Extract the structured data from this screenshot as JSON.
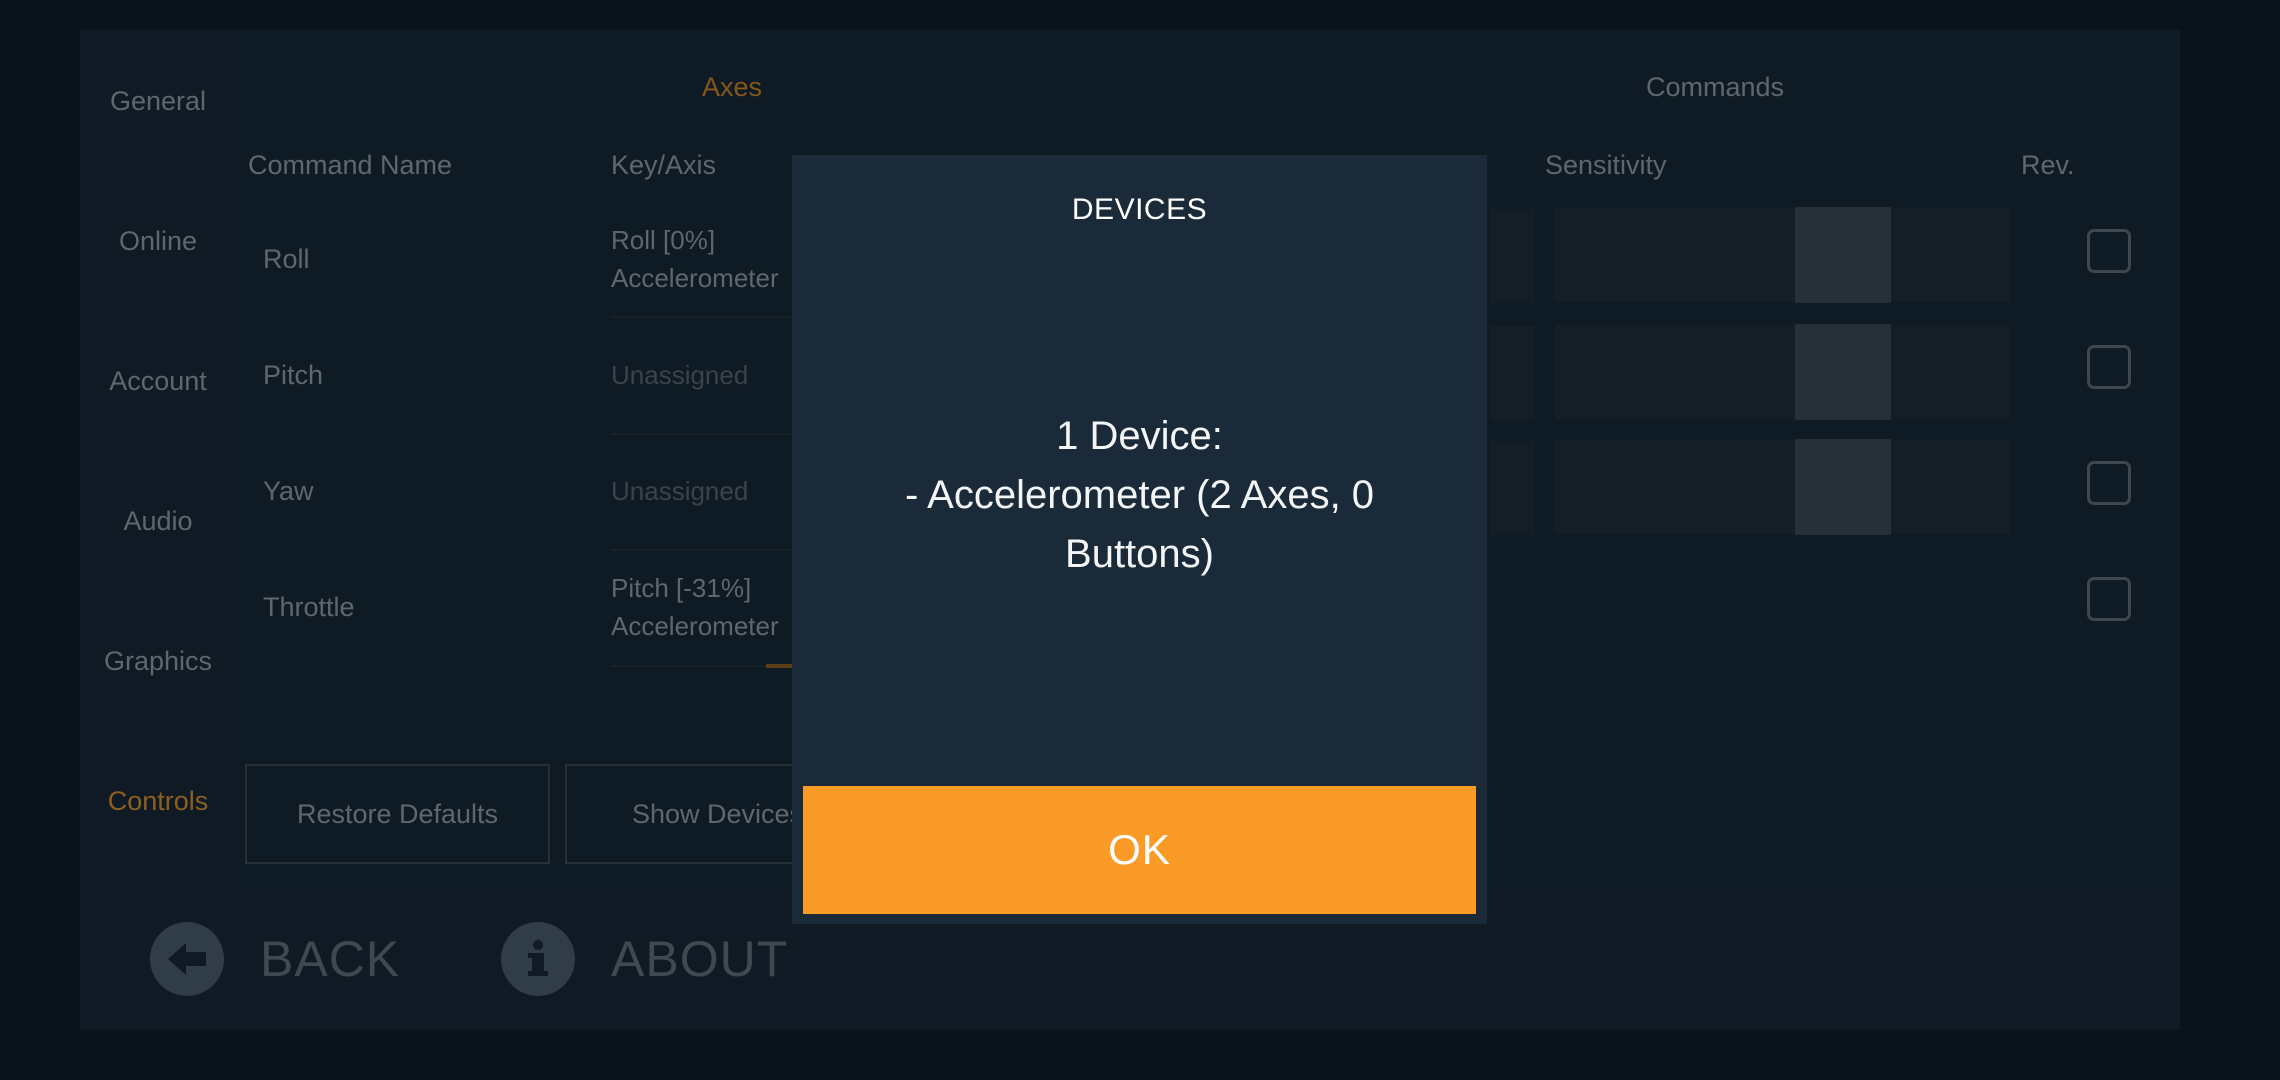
{
  "sidebar": {
    "items": [
      {
        "label": "General",
        "active": false
      },
      {
        "label": "Online",
        "active": false
      },
      {
        "label": "Account",
        "active": false
      },
      {
        "label": "Audio",
        "active": false
      },
      {
        "label": "Graphics",
        "active": false
      },
      {
        "label": "Controls",
        "active": true
      }
    ]
  },
  "tabs": [
    {
      "label": "Axes",
      "active": true
    },
    {
      "label": "Commands",
      "active": false
    }
  ],
  "columns": {
    "command_name": "Command Name",
    "key_axis": "Key/Axis",
    "sensitivity": "Sensitivity",
    "rev": "Rev."
  },
  "rows": [
    {
      "name": "Roll",
      "key_line1": "Roll [0%]",
      "key_line2": "Accelerometer"
    },
    {
      "name": "Pitch",
      "key_line1": "Unassigned",
      "key_line2": ""
    },
    {
      "name": "Yaw",
      "key_line1": "Unassigned",
      "key_line2": ""
    },
    {
      "name": "Throttle",
      "key_line1": "Pitch [-31%]",
      "key_line2": "Accelerometer"
    }
  ],
  "buttons": {
    "restore_defaults": "Restore Defaults",
    "show_devices": "Show Devices"
  },
  "bottom_nav": {
    "back": "BACK",
    "about": "ABOUT"
  },
  "modal": {
    "title": "DEVICES",
    "body_line1": "1 Device:",
    "body_line2": "- Accelerometer (2 Axes, 0",
    "body_line3": "Buttons)",
    "ok_label": "OK"
  },
  "colors": {
    "accent": "#fa9b27",
    "active_nav": "#d48a2a",
    "modal_bg": "#1b2a38"
  },
  "icons": {
    "back": "arrow-left-circle-icon",
    "about": "info-circle-icon"
  }
}
